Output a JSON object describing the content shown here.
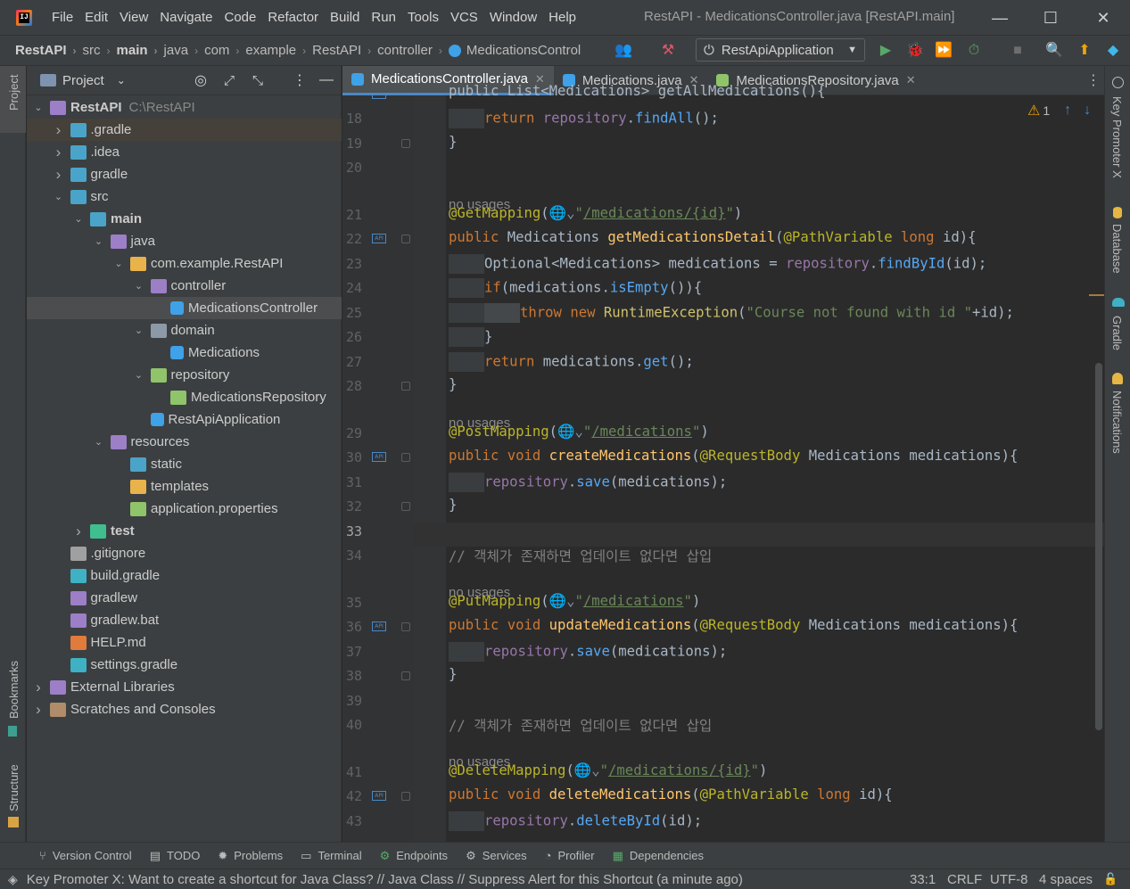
{
  "menu": [
    "File",
    "Edit",
    "View",
    "Navigate",
    "Code",
    "Refactor",
    "Build",
    "Run",
    "Tools",
    "VCS",
    "Window",
    "Help"
  ],
  "window_title": "RestAPI - MedicationsController.java [RestAPI.main]",
  "breadcrumbs": [
    "RestAPI",
    "src",
    "main",
    "java",
    "com",
    "example",
    "RestAPI",
    "controller",
    "MedicationsControl"
  ],
  "run_config": "RestApiApplication",
  "project_panel": {
    "title": "Project"
  },
  "tree": [
    {
      "label": "RestAPI",
      "extra": "C:\\RestAPI",
      "depth": 0,
      "arrow": "down",
      "icon": "module",
      "bold": true
    },
    {
      "label": ".gradle",
      "depth": 1,
      "arrow": "right",
      "icon": "folder-gradle",
      "highlight": true
    },
    {
      "label": ".idea",
      "depth": 1,
      "arrow": "right",
      "icon": "folder-idea"
    },
    {
      "label": "gradle",
      "depth": 1,
      "arrow": "right",
      "icon": "folder-gradle"
    },
    {
      "label": "src",
      "depth": 1,
      "arrow": "down",
      "icon": "folder-src"
    },
    {
      "label": "main",
      "depth": 2,
      "arrow": "down",
      "icon": "folder-main",
      "bold": true
    },
    {
      "label": "java",
      "depth": 3,
      "arrow": "down",
      "icon": "folder-java"
    },
    {
      "label": "com.example.RestAPI",
      "depth": 4,
      "arrow": "down",
      "icon": "package"
    },
    {
      "label": "controller",
      "depth": 5,
      "arrow": "down",
      "icon": "package-controller"
    },
    {
      "label": "MedicationsController",
      "depth": 6,
      "arrow": "",
      "icon": "class",
      "selected": true
    },
    {
      "label": "domain",
      "depth": 5,
      "arrow": "down",
      "icon": "package-domain"
    },
    {
      "label": "Medications",
      "depth": 6,
      "arrow": "",
      "icon": "class"
    },
    {
      "label": "repository",
      "depth": 5,
      "arrow": "down",
      "icon": "package-repository"
    },
    {
      "label": "MedicationsRepository",
      "depth": 6,
      "arrow": "",
      "icon": "interface"
    },
    {
      "label": "RestApiApplication",
      "depth": 5,
      "arrow": "",
      "icon": "spring-class"
    },
    {
      "label": "resources",
      "depth": 3,
      "arrow": "down",
      "icon": "folder-resources"
    },
    {
      "label": "static",
      "depth": 4,
      "arrow": "",
      "icon": "folder-static"
    },
    {
      "label": "templates",
      "depth": 4,
      "arrow": "",
      "icon": "folder-templates"
    },
    {
      "label": "application.properties",
      "depth": 4,
      "arrow": "",
      "icon": "properties"
    },
    {
      "label": "test",
      "depth": 2,
      "arrow": "right",
      "icon": "folder-test",
      "bold": true
    },
    {
      "label": ".gitignore",
      "depth": 1,
      "arrow": "",
      "icon": "gitignore"
    },
    {
      "label": "build.gradle",
      "depth": 1,
      "arrow": "",
      "icon": "gradle-file"
    },
    {
      "label": "gradlew",
      "depth": 1,
      "arrow": "",
      "icon": "gradlew"
    },
    {
      "label": "gradlew.bat",
      "depth": 1,
      "arrow": "",
      "icon": "gradlew"
    },
    {
      "label": "HELP.md",
      "depth": 1,
      "arrow": "",
      "icon": "markdown"
    },
    {
      "label": "settings.gradle",
      "depth": 1,
      "arrow": "",
      "icon": "gradle-file"
    },
    {
      "label": "External Libraries",
      "depth": 0,
      "arrow": "right",
      "icon": "libraries"
    },
    {
      "label": "Scratches and Consoles",
      "depth": 0,
      "arrow": "right",
      "icon": "scratches"
    }
  ],
  "editor_tabs": [
    {
      "label": "MedicationsController.java",
      "active": true
    },
    {
      "label": "Medications.java",
      "active": false
    },
    {
      "label": "MedicationsRepository.java",
      "active": false
    }
  ],
  "inspections": {
    "warnings": "1"
  },
  "code_top_partial": "public List<Medications> getAllMedications(){",
  "code_lines": [
    {
      "n": "18",
      "t": "line",
      "html": "<span class='indent' style='width:40px'></span><span class='kw'>return </span><span class='fd'>repository</span>.<span class='mc'>findAll</span>();"
    },
    {
      "n": "19",
      "t": "line",
      "html": "}"
    },
    {
      "n": "20",
      "t": "line",
      "html": ""
    },
    {
      "t": "hint",
      "text": "no usages"
    },
    {
      "n": "21",
      "t": "line",
      "html": "<span class='an'>@GetMapping</span>(<span style='color:#8a9bb5'>🌐⌄</span><span class='st'>\"</span><span class='stl'>/medications/{id}</span><span class='st'>\"</span>)"
    },
    {
      "n": "22",
      "t": "line",
      "api": true,
      "html": "<span class='kw'>public </span>Medications <span class='fn'>getMedicationsDetail</span>(<span class='an'>@PathVariable </span><span class='kw'>long </span>id){"
    },
    {
      "n": "23",
      "t": "line",
      "html": "<span class='indent' style='width:40px'></span>Optional&lt;Medications&gt; medications = <span class='fd'>repository</span>.<span class='mc'>findById</span>(id);"
    },
    {
      "n": "24",
      "t": "line",
      "html": "<span class='indent' style='width:40px'></span><span class='kw'>if</span>(medications.<span class='mc'>isEmpty</span>()){"
    },
    {
      "n": "25",
      "t": "line",
      "html": "<span class='indent' style='width:40px'></span><span class='indent' style='width:40px;background:#45484a'></span><span class='kw'>throw new </span><span class='ty'>RuntimeException</span>(<span class='st'>\"Course not found with id \"</span>+id);"
    },
    {
      "n": "26",
      "t": "line",
      "html": "<span class='indent' style='width:40px'></span>}"
    },
    {
      "n": "27",
      "t": "line",
      "html": "<span class='indent' style='width:40px'></span><span class='kw'>return </span>medications.<span class='mc'>get</span>();"
    },
    {
      "n": "28",
      "t": "line",
      "html": "}"
    },
    {
      "t": "hint",
      "text": "no usages"
    },
    {
      "n": "29",
      "t": "line",
      "html": "<span class='an'>@PostMapping</span>(<span style='color:#8a9bb5'>🌐⌄</span><span class='st'>\"</span><span class='stl'>/medications</span><span class='st'>\"</span>)"
    },
    {
      "n": "30",
      "t": "line",
      "api": true,
      "html": "<span class='kw'>public void </span><span class='fn'>createMedications</span>(<span class='an'>@RequestBody </span>Medications medications){"
    },
    {
      "n": "31",
      "t": "line",
      "html": "<span class='indent' style='width:40px'></span><span class='fd'>repository</span>.<span class='mc'>save</span>(medications);"
    },
    {
      "n": "32",
      "t": "line",
      "html": "}"
    },
    {
      "n": "33",
      "t": "line",
      "cur": true,
      "html": ""
    },
    {
      "n": "34",
      "t": "line",
      "html": "<span class='cm'>// 객체가 존재하면 업데이트 없다면 삽입</span>"
    },
    {
      "t": "hint",
      "text": "no usages"
    },
    {
      "n": "35",
      "t": "line",
      "html": "<span class='an'>@PutMapping</span>(<span style='color:#8a9bb5'>🌐⌄</span><span class='st'>\"</span><span class='stl'>/medications</span><span class='st'>\"</span>)"
    },
    {
      "n": "36",
      "t": "line",
      "api": true,
      "html": "<span class='kw'>public void </span><span class='fn'>updateMedications</span>(<span class='an'>@RequestBody </span>Medications medications){"
    },
    {
      "n": "37",
      "t": "line",
      "html": "<span class='indent' style='width:40px'></span><span class='fd'>repository</span>.<span class='mc'>save</span>(medications);"
    },
    {
      "n": "38",
      "t": "line",
      "html": "}"
    },
    {
      "n": "39",
      "t": "line",
      "html": ""
    },
    {
      "n": "40",
      "t": "line",
      "html": "<span class='cm'>// 객체가 존재하면 업데이트 없다면 삽입</span>"
    },
    {
      "t": "hint",
      "text": "no usages"
    },
    {
      "n": "41",
      "t": "line",
      "html": "<span class='an'>@DeleteMapping</span>(<span style='color:#8a9bb5'>🌐⌄</span><span class='st'>\"</span><span class='stl'>/medications/{id}</span><span class='st'>\"</span>)"
    },
    {
      "n": "42",
      "t": "line",
      "api": true,
      "html": "<span class='kw'>public void </span><span class='fn'>deleteMedications</span>(<span class='an'>@PathVariable </span><span class='kw'>long </span>id){"
    },
    {
      "n": "43",
      "t": "line",
      "html": "<span class='indent' style='width:40px'></span><span class='fd'>repository</span>.<span class='mc'>deleteById</span>(id);"
    }
  ],
  "left_strip": [
    "Project",
    "Bookmarks",
    "Structure"
  ],
  "right_strip": [
    "Key Promoter X",
    "Database",
    "Gradle",
    "Notifications"
  ],
  "bottom_tools": [
    "Version Control",
    "TODO",
    "Problems",
    "Terminal",
    "Endpoints",
    "Services",
    "Profiler",
    "Dependencies"
  ],
  "status": {
    "message": "Key Promoter X: Want to create a shortcut for Java Class? // Java Class // Suppress Alert for this Shortcut (a minute ago)",
    "position": "33:1",
    "line_sep": "CRLF",
    "encoding": "UTF-8",
    "indent": "4 spaces"
  },
  "colors": {
    "accent": "#4a88c7",
    "keyword": "#cc7832",
    "annotation": "#bbb529",
    "method": "#ffc66d",
    "field": "#9876aa",
    "string": "#6a8759"
  }
}
